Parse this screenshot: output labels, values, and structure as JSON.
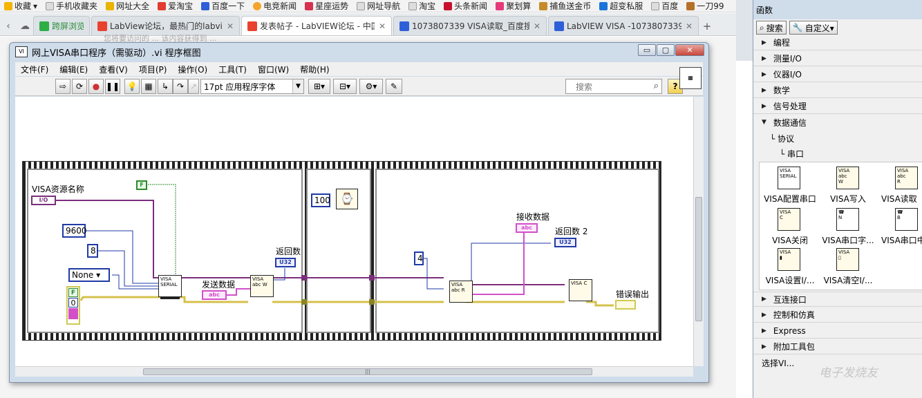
{
  "favorites": [
    "收藏",
    "手机收藏夹",
    "网址大全",
    "爱淘宝",
    "百度一下",
    "电竞新闻",
    "星座运势",
    "网址导航",
    "淘宝",
    "头条新闻",
    "聚划算",
    "捕鱼送金币",
    "超变私服",
    "百度",
    "一刀99"
  ],
  "browser_tabs": [
    {
      "label": "跨屏浏览",
      "active": false
    },
    {
      "label": "LabView论坛，最热门的labvie",
      "active": false
    },
    {
      "label": "发表帖子 - LabVIEW论坛 - 中国",
      "active": true
    },
    {
      "label": "1073807339 VISA读取_百度搜",
      "active": false
    },
    {
      "label": "LabVIEW VISA -1073807339",
      "active": false
    }
  ],
  "page_fragment": "您将要访问的 ...  该内容获得到 ...",
  "window": {
    "title": "网上VISA串口程序（需驱动）.vi 程序框图",
    "min": "▭",
    "max": "▢",
    "close": "✕"
  },
  "menu": [
    "文件(F)",
    "编辑(E)",
    "查看(V)",
    "项目(P)",
    "操作(O)",
    "工具(T)",
    "窗口(W)",
    "帮助(H)"
  ],
  "toolbar": {
    "font": "17pt 应用程序字体",
    "search_placeholder": "搜索",
    "help": "?"
  },
  "diagram": {
    "visa_resource_label": "VISA资源名称",
    "visa_resource_ind": "I/O",
    "const_baud": "9600",
    "const_bits": "8",
    "const_parity": "None",
    "bool_false": "F",
    "numeric_zero": "0",
    "send_data_label": "发送数据",
    "send_data_ind": "abc",
    "return_count_label": "返回数",
    "return_count_ind": "U32",
    "wait_ms": "100",
    "read_count": "4",
    "recv_data_label": "接收数据",
    "recv_data_ind": "abc",
    "return_count2_label": "返回数 2",
    "return_count2_ind": "U32",
    "error_out_label": "错误输出",
    "visa_config_text": "VISA SERIAL",
    "visa_write_text": "VISA abc W",
    "visa_read_text": "VISA abc R",
    "visa_close_text": "VISA C"
  },
  "palette": {
    "title": "函数",
    "search": "搜索",
    "custom": "自定义▾",
    "categories_top": [
      "编程",
      "测量I/O",
      "仪器I/O",
      "数学",
      "信号处理",
      "数据通信"
    ],
    "sub1": "协议",
    "sub2": "串口",
    "icons": [
      "VISA配置串口",
      "VISA写入",
      "VISA读取",
      "VISA关闭",
      "VISA串口字...",
      "VISA串口中...",
      "VISA设置I/...",
      "VISA清空I/..."
    ],
    "categories_bottom": [
      "互连接口",
      "控制和仿真",
      "Express",
      "附加工具包",
      "选择VI..."
    ]
  },
  "watermark": "电子发烧友"
}
